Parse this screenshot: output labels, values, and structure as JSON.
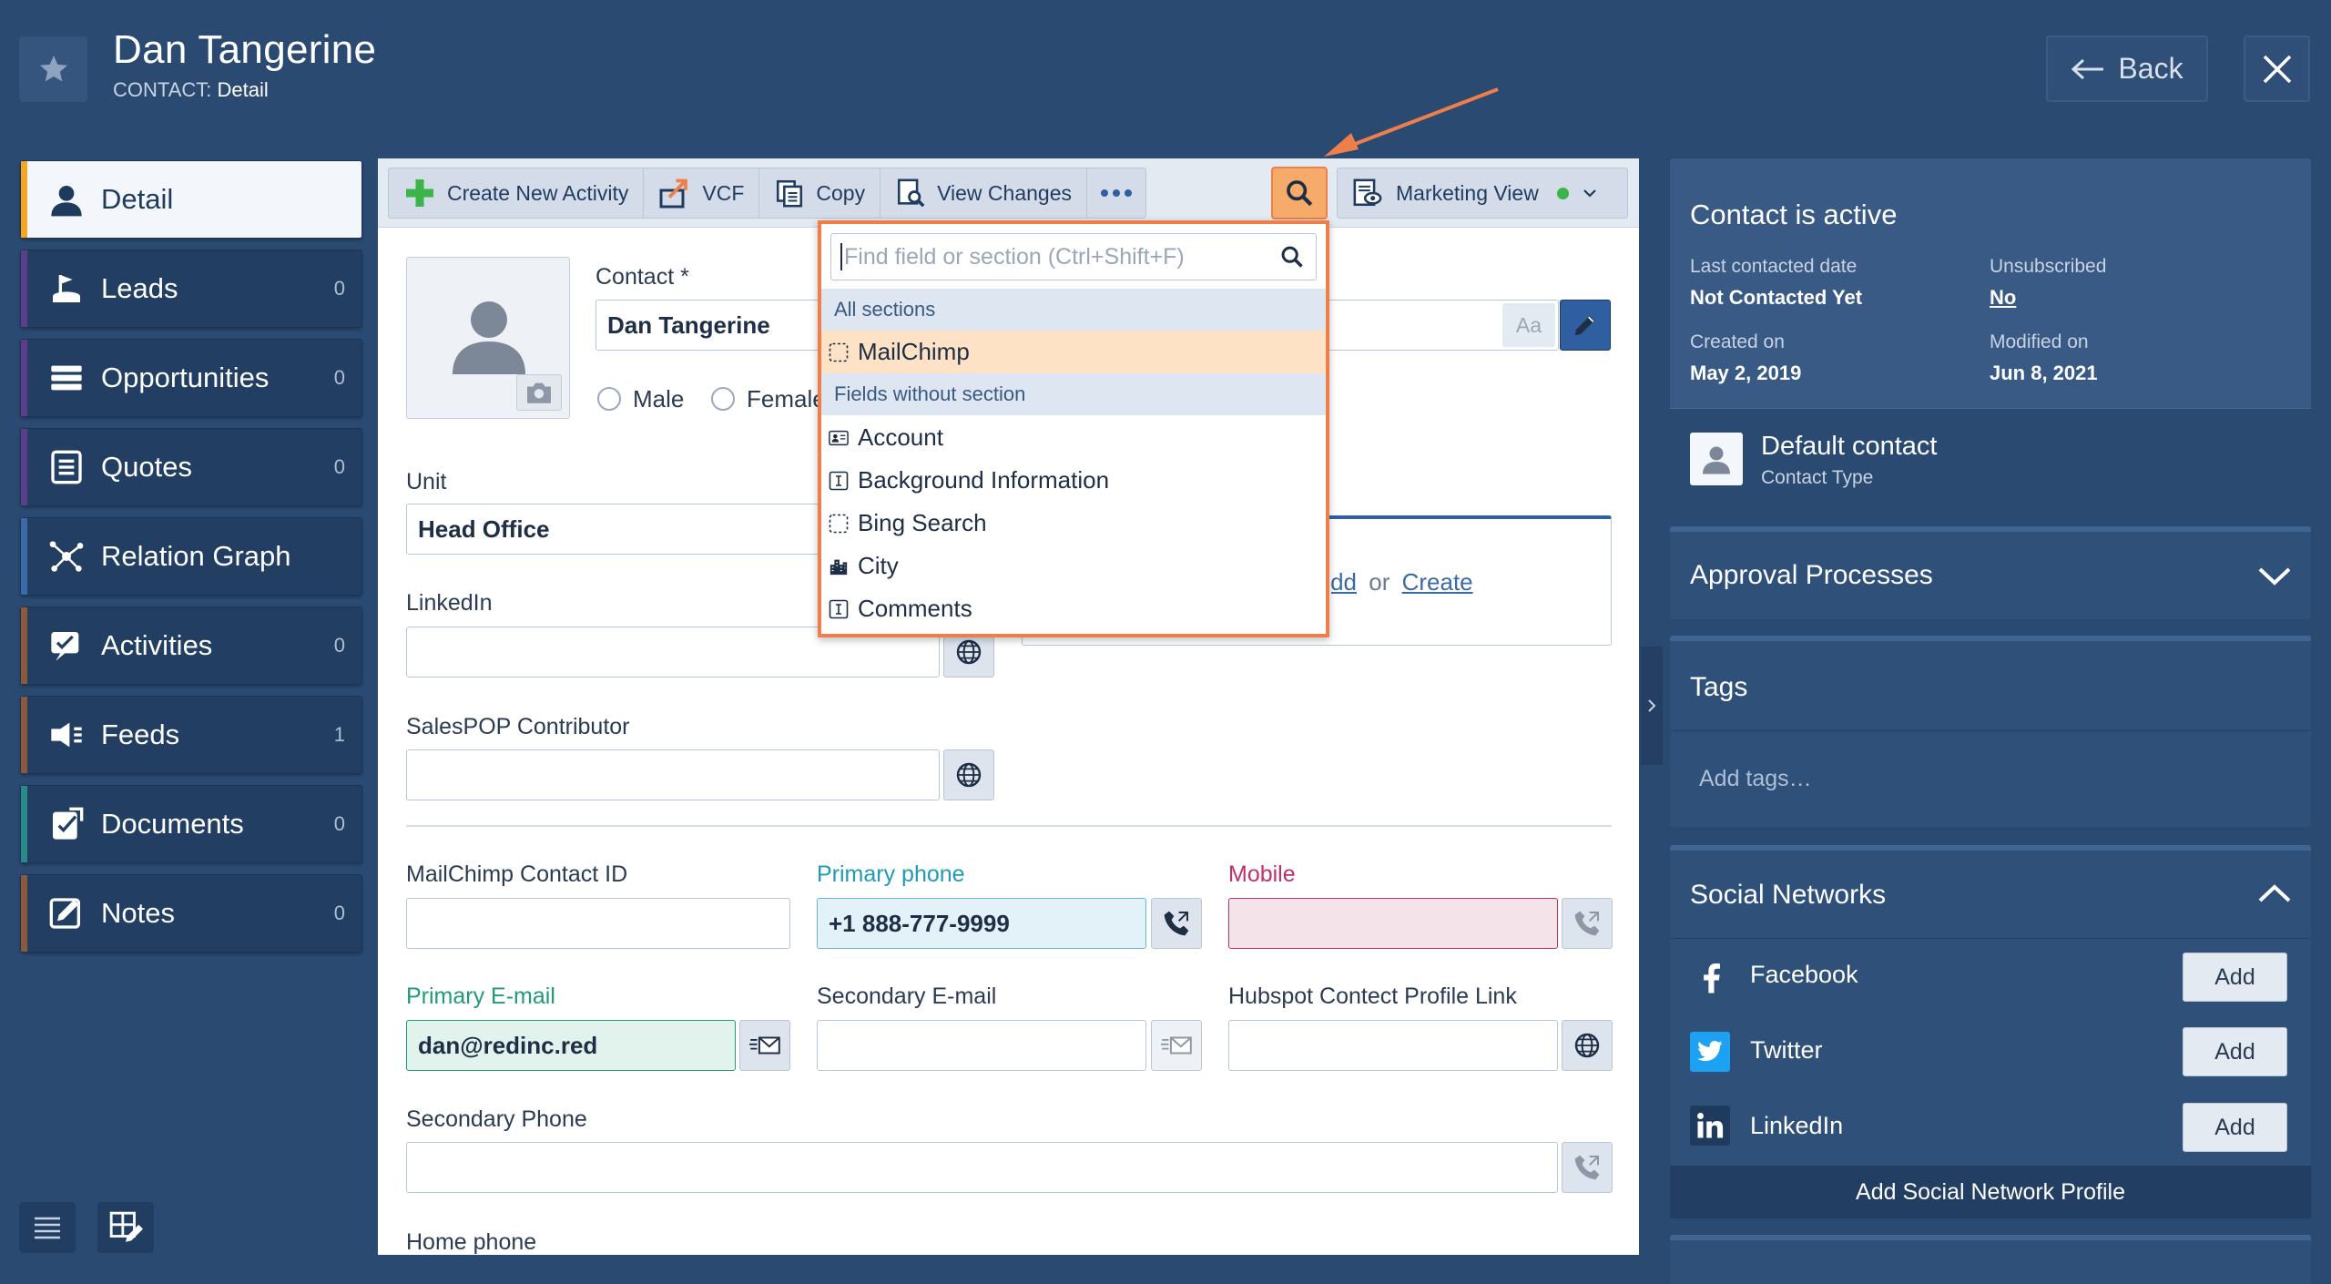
{
  "header": {
    "title": "Dan Tangerine",
    "subtitle_prefix": "CONTACT:",
    "subtitle_value": "Detail",
    "back_label": "Back"
  },
  "sidebar": {
    "items": [
      {
        "label": "Detail",
        "count": "",
        "icon": "person-icon",
        "color": "#f5a623"
      },
      {
        "label": "Leads",
        "count": "0",
        "icon": "leads-icon",
        "color": "#5b3f8a"
      },
      {
        "label": "Opportunities",
        "count": "0",
        "icon": "list-icon",
        "color": "#5b3f8a"
      },
      {
        "label": "Quotes",
        "count": "0",
        "icon": "quotes-icon",
        "color": "#5b3f8a"
      },
      {
        "label": "Relation Graph",
        "count": "",
        "icon": "graph-icon",
        "color": "#3a6aa8"
      },
      {
        "label": "Activities",
        "count": "0",
        "icon": "activities-icon",
        "color": "#8b5a3c"
      },
      {
        "label": "Feeds",
        "count": "1",
        "icon": "feeds-icon",
        "color": "#8b5a3c"
      },
      {
        "label": "Documents",
        "count": "0",
        "icon": "documents-icon",
        "color": "#2a8a8a"
      },
      {
        "label": "Notes",
        "count": "0",
        "icon": "notes-icon",
        "color": "#8b5a3c"
      }
    ]
  },
  "toolbar": {
    "create_activity": "Create New Activity",
    "vcf": "VCF",
    "copy": "Copy",
    "view_changes": "View Changes",
    "marketing_view": "Marketing View"
  },
  "form": {
    "contact_label": "Contact *",
    "contact_value": "Dan Tangerine",
    "aa_label": "Aa",
    "male_label": "Male",
    "female_label": "Female",
    "unit_label": "Unit",
    "unit_value": "Head Office",
    "add_link": "Add",
    "or_text": "or",
    "create_link": "Create",
    "linkedin_label": "LinkedIn",
    "salespop_label": "SalesPOP Contributor",
    "mailchimp_id_label": "MailChimp Contact ID",
    "primary_phone_label": "Primary phone",
    "primary_phone_value": "+1 888-777-9999",
    "mobile_label": "Mobile",
    "primary_email_label": "Primary E-mail",
    "primary_email_value": "dan@redinc.red",
    "secondary_email_label": "Secondary E-mail",
    "hubspot_label": "Hubspot Contect Profile Link",
    "secondary_phone_label": "Secondary Phone",
    "home_phone_label": "Home phone"
  },
  "dropdown": {
    "placeholder": "Find field or section (Ctrl+Shift+F)",
    "section_all": "All sections",
    "mailchimp": "MailChimp",
    "section_fields": "Fields without section",
    "items": [
      "Account",
      "Background Information",
      "Bing Search",
      "City",
      "Comments"
    ]
  },
  "right": {
    "status": "Contact is active",
    "last_contacted_label": "Last contacted date",
    "last_contacted_value": "Not Contacted Yet",
    "unsubscribed_label": "Unsubscribed",
    "unsubscribed_value": "No",
    "created_label": "Created on",
    "created_value": "May 2, 2019",
    "modified_label": "Modified on",
    "modified_value": "Jun 8, 2021",
    "contact_type_value": "Default contact",
    "contact_type_label": "Contact Type",
    "approval": "Approval Processes",
    "tags": "Tags",
    "add_tags": "Add tags…",
    "social": "Social Networks",
    "facebook": "Facebook",
    "twitter": "Twitter",
    "linkedin": "LinkedIn",
    "add_label": "Add",
    "add_profile": "Add Social Network Profile"
  },
  "colors": {
    "accent_orange": "#ee7f4b",
    "primary_phone": "#1f9bb6",
    "mobile": "#c0306b",
    "primary_email": "#1f9b7a",
    "active_dot": "#3bb54a"
  }
}
